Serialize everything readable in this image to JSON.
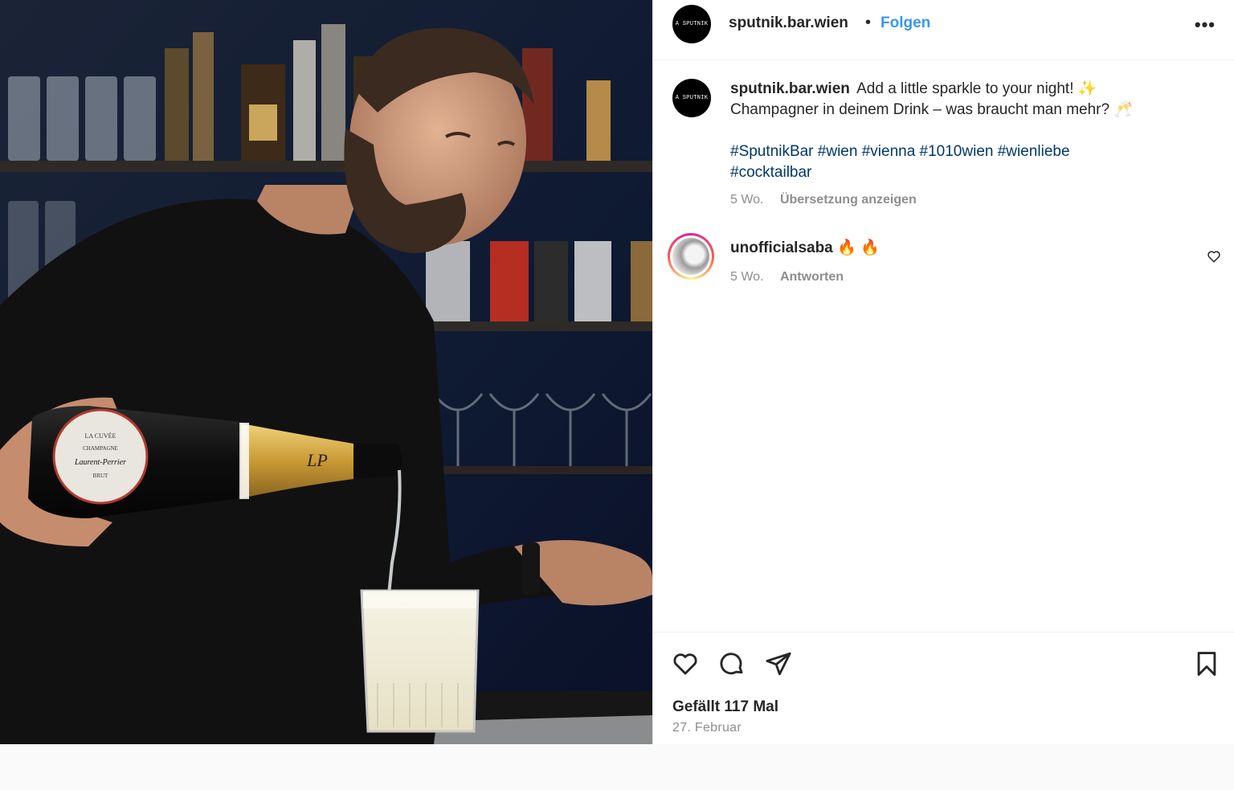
{
  "post": {
    "username": "sputnik.bar.wien",
    "avatar_text": "A SPUTNIK",
    "separator": "•",
    "follow_label": "Folgen",
    "more_label": "•••",
    "caption_line1": "Add a little sparkle to your night! ✨",
    "caption_line2": "Champagner in deinem Drink – was braucht man mehr? 🥂",
    "hashtags_line1": "#SputnikBar #wien #vienna #1010wien #wienliebe",
    "hashtags_line2": "#cocktailbar",
    "age": "5 Wo.",
    "translate_label": "Übersetzung anzeigen"
  },
  "comments": [
    {
      "username": "unofficialsaba",
      "text": "🔥 🔥",
      "age": "5 Wo.",
      "reply_label": "Antworten"
    }
  ],
  "footer": {
    "likes": "Gefällt 117 Mal",
    "date": "27. Februar"
  },
  "photo": {
    "bottle_label_lines": [
      "LA CUVÉE",
      "CHAMPAGNE",
      "Laurent-Perrier",
      "BRUT"
    ],
    "neck_monogram": "LP"
  },
  "colors": {
    "link": "#3897f0",
    "hashtag": "#00376b",
    "muted": "#8e8e8e",
    "text": "#262626"
  }
}
